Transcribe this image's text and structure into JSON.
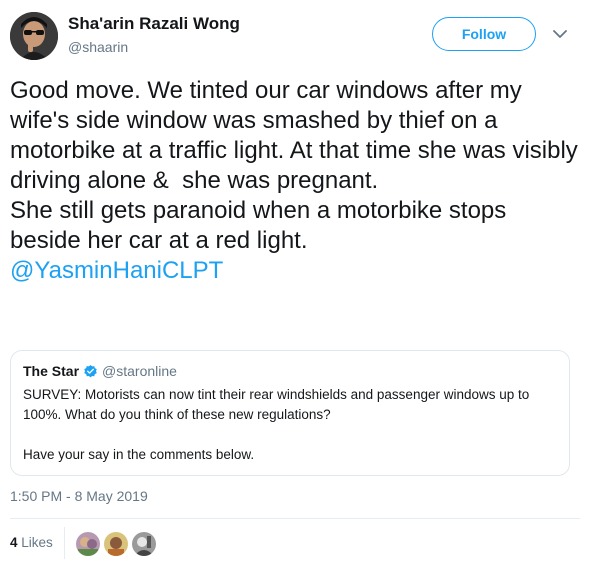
{
  "author": {
    "name": "Sha'arin Razali Wong",
    "handle": "@shaarin"
  },
  "follow_label": "Follow",
  "tweet": {
    "paragraphs": [
      "Good move. We tinted our car windows after my wife's side window was smashed by thief on a motorbike at a traffic light. At that time she was visibly driving alone &  she was pregnant.",
      "She still gets paranoid when a motorbike stops beside her car at a red light."
    ],
    "mention": "@YasminHaniCLPT"
  },
  "quoted": {
    "name": "The Star",
    "handle": "@staronline",
    "text": "SURVEY: Motorists can now tint their rear windshields and passenger windows up to 100%. What do you think of these new regulations?\n\nHave your say in the comments below."
  },
  "timestamp": "1:50 PM - 8 May 2019",
  "likes": {
    "count": "4",
    "label": "Likes"
  },
  "colors": {
    "accent": "#1da1f2",
    "secondary_text": "#657786",
    "border": "#e1e8ed"
  },
  "icons": [
    "chevron-down-icon",
    "verified-badge-icon"
  ]
}
